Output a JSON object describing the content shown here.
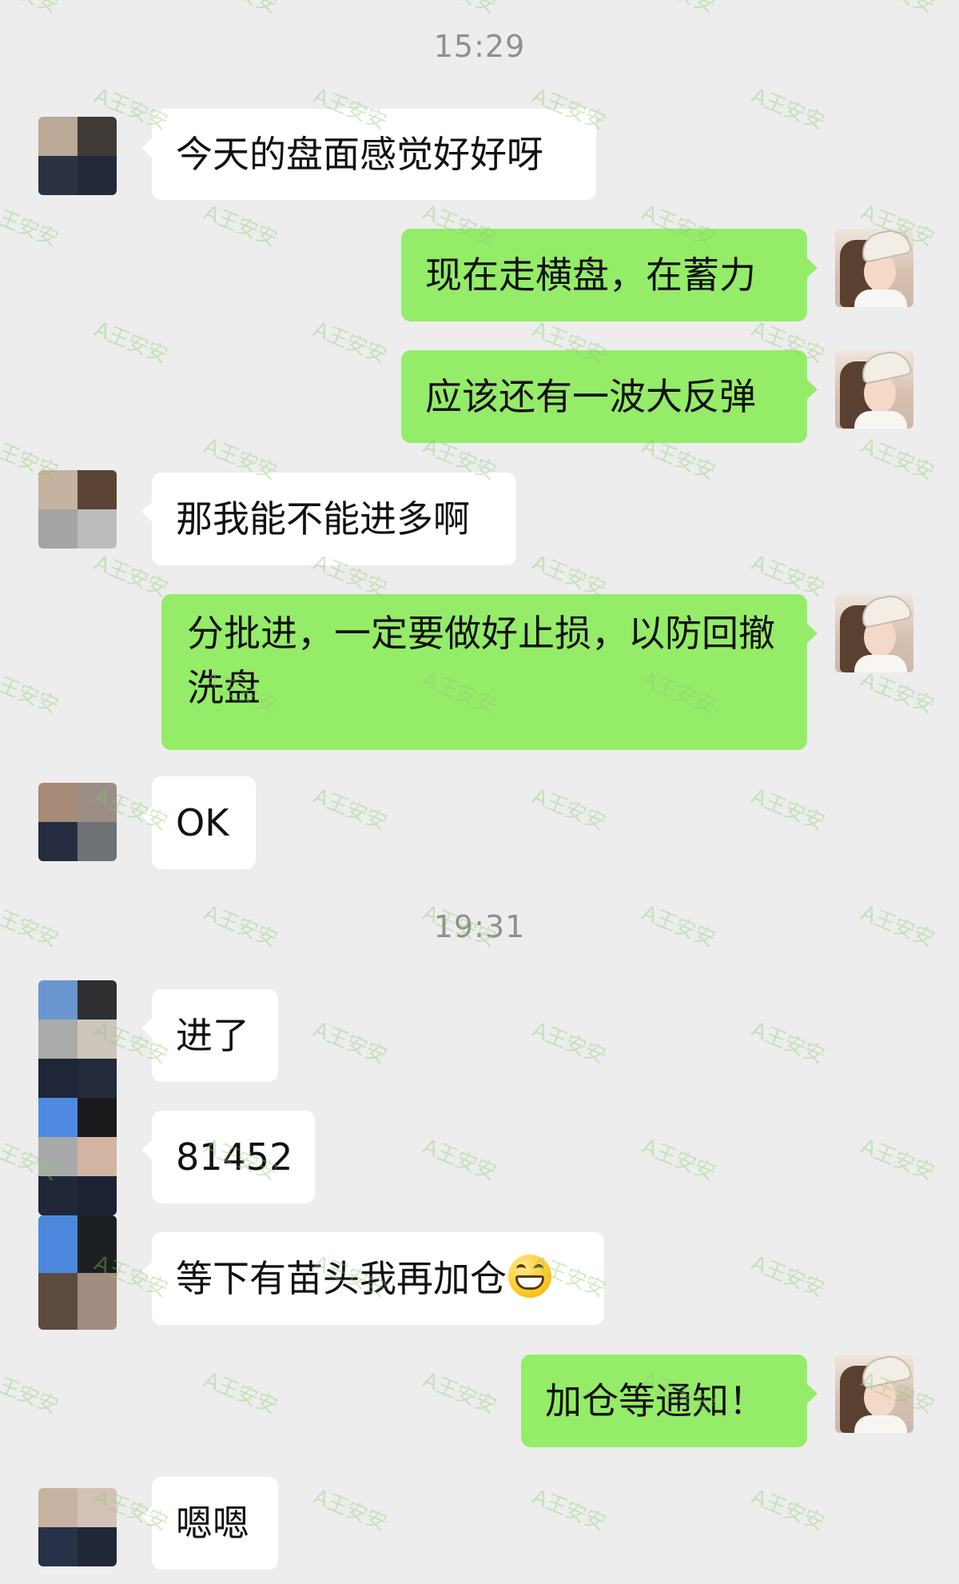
{
  "timestamps": [
    "15:29",
    "19:31"
  ],
  "watermark": "A王安安",
  "colors": {
    "background": "#ededed",
    "incoming_bubble": "#ffffff",
    "outgoing_bubble": "#95ec69",
    "text": "#111111",
    "timestamp": "#8f8f8f"
  },
  "messages": [
    {
      "side": "left",
      "text": "今天的盘面感觉好好呀"
    },
    {
      "side": "right",
      "text": "现在走横盘，在蓄力"
    },
    {
      "side": "right",
      "text": "应该还有一波大反弹"
    },
    {
      "side": "left",
      "text": "那我能不能进多啊"
    },
    {
      "side": "right",
      "text": "分批进，一定要做好止损，以防回撤洗盘"
    },
    {
      "side": "left",
      "text": "OK"
    },
    {
      "side": "left",
      "text": "进了"
    },
    {
      "side": "left",
      "text": "81452"
    },
    {
      "side": "left",
      "text": "等下有苗头我再加仓",
      "emoji": "grinning-face-icon"
    },
    {
      "side": "right",
      "text": "加仓等通知！"
    },
    {
      "side": "left",
      "text": "嗯嗯"
    }
  ]
}
